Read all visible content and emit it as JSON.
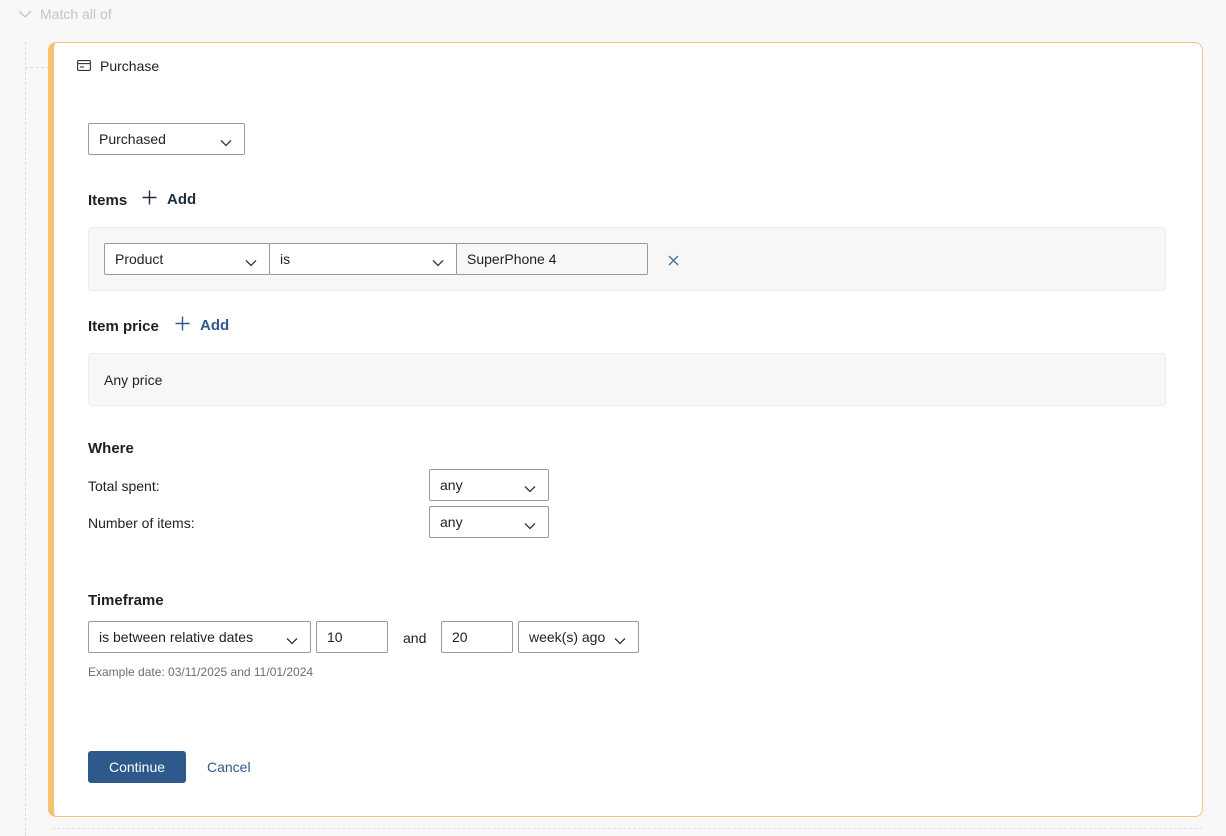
{
  "header": {
    "match_label": "Match all of"
  },
  "card": {
    "title": "Purchase",
    "event_select": "Purchased",
    "items": {
      "label": "Items",
      "add_label": "Add",
      "rule": {
        "field": "Product",
        "operator": "is",
        "value": "SuperPhone 4"
      }
    },
    "item_price": {
      "label": "Item price",
      "add_label": "Add",
      "placeholder_text": "Any price"
    },
    "where": {
      "label": "Where",
      "rows": [
        {
          "label": "Total spent:",
          "value": "any"
        },
        {
          "label": "Number of items:",
          "value": "any"
        }
      ]
    },
    "timeframe": {
      "label": "Timeframe",
      "operator": "is between relative dates",
      "from": "10",
      "and_label": "and",
      "to": "20",
      "unit": "week(s) ago",
      "example": "Example date: 03/11/2025 and 11/01/2024"
    },
    "actions": {
      "continue_label": "Continue",
      "cancel_label": "Cancel"
    }
  },
  "colors": {
    "accent_border": "#f5c271",
    "primary": "#2d5a8a",
    "items_add_color": "#1f2d3d",
    "price_add_color": "#2d5a8a"
  }
}
